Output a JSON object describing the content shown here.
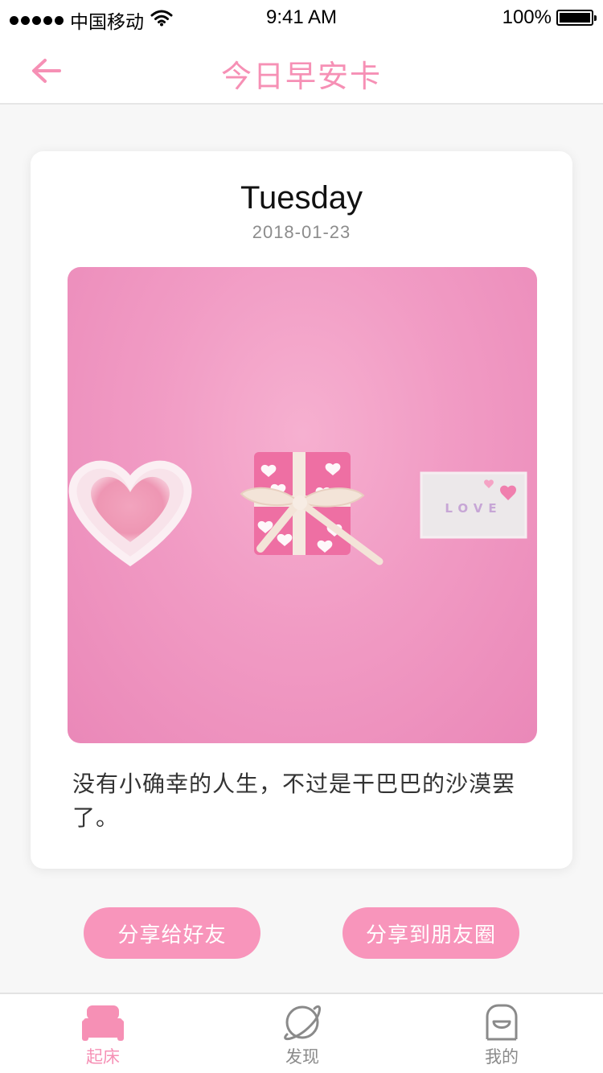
{
  "status_bar": {
    "carrier": "中国移动",
    "time": "9:41 AM",
    "battery": "100%",
    "battery_level": 1.0
  },
  "nav": {
    "title": "今日早安卡",
    "back_icon": "arrow-left-icon"
  },
  "card": {
    "day": "Tuesday",
    "date": "2018-01-23",
    "photo_label": "LOVE",
    "quote": "没有小确幸的人生，不过是干巴巴的沙漠罢了。"
  },
  "actions": {
    "share_friend": "分享给好友",
    "share_moments": "分享到朋友圈"
  },
  "tabs": [
    {
      "label": "起床",
      "icon": "bed-icon",
      "active": true
    },
    {
      "label": "发现",
      "icon": "planet-icon",
      "active": false
    },
    {
      "label": "我的",
      "icon": "profile-icon",
      "active": false
    }
  ],
  "colors": {
    "accent": "#f690b5",
    "button": "#f895bb",
    "inactive": "#8a8a8a"
  }
}
